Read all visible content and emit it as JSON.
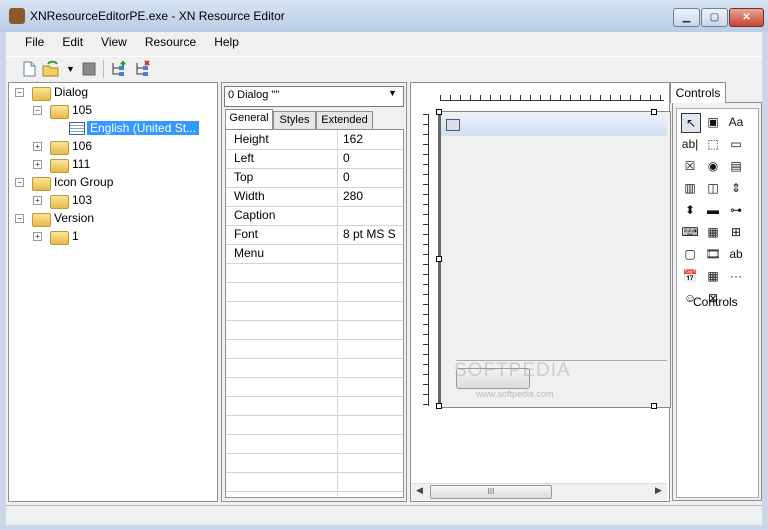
{
  "window": {
    "title": "XNResourceEditorPE.exe - XN Resource Editor"
  },
  "menu": [
    "File",
    "Edit",
    "View",
    "Resource",
    "Help"
  ],
  "tree": {
    "dialog": "Dialog",
    "n105": "105",
    "english": "English (United St...",
    "n106": "106",
    "n111": "111",
    "icon_group": "Icon Group",
    "n103": "103",
    "version": "Version",
    "n1": "1"
  },
  "properties": {
    "combo_value": "0 Dialog \"\"",
    "tabs": [
      "General",
      "Styles",
      "Extended"
    ],
    "rows": [
      {
        "name": "Height",
        "value": "162"
      },
      {
        "name": "Left",
        "value": "0"
      },
      {
        "name": "Top",
        "value": "0"
      },
      {
        "name": "Width",
        "value": "280"
      },
      {
        "name": "Caption",
        "value": ""
      },
      {
        "name": "Font",
        "value": "8 pt MS S"
      },
      {
        "name": "Menu",
        "value": ""
      }
    ]
  },
  "design": {
    "watermark": "SOFTPEDIA",
    "watermark_url": "www.softpedia.com",
    "scroll_grip": "III"
  },
  "controls": {
    "tab_label": "Controls",
    "overlay_label": "Controls",
    "icons": [
      "pointer-icon",
      "picture-icon",
      "static-text-icon",
      "edit-icon",
      "group-box-icon",
      "button-icon",
      "checkbox-icon",
      "radio-icon",
      "combobox-icon",
      "listbox-icon",
      "hscroll-icon",
      "vscroll-icon",
      "spin-icon",
      "progress-icon",
      "slider-icon",
      "hotkey-icon",
      "date-icon",
      "tree-icon",
      "tab-icon",
      "animate-icon",
      "rich-edit-icon",
      "calendar-icon",
      "grid-icon",
      "ip-icon",
      "custom-icon",
      "extended-combo-icon"
    ],
    "glyphs": [
      "↖",
      "▣",
      "Aa",
      "ab|",
      "⬚",
      "▭",
      "☒",
      "◉",
      "▤",
      "▥",
      "◫",
      "⇕",
      "⬍",
      "▬",
      "⊶",
      "⌨",
      "▦",
      "⊞",
      "▢",
      "🎞",
      "ab",
      "📅",
      "▦",
      "···",
      "☺",
      "⊠"
    ]
  }
}
